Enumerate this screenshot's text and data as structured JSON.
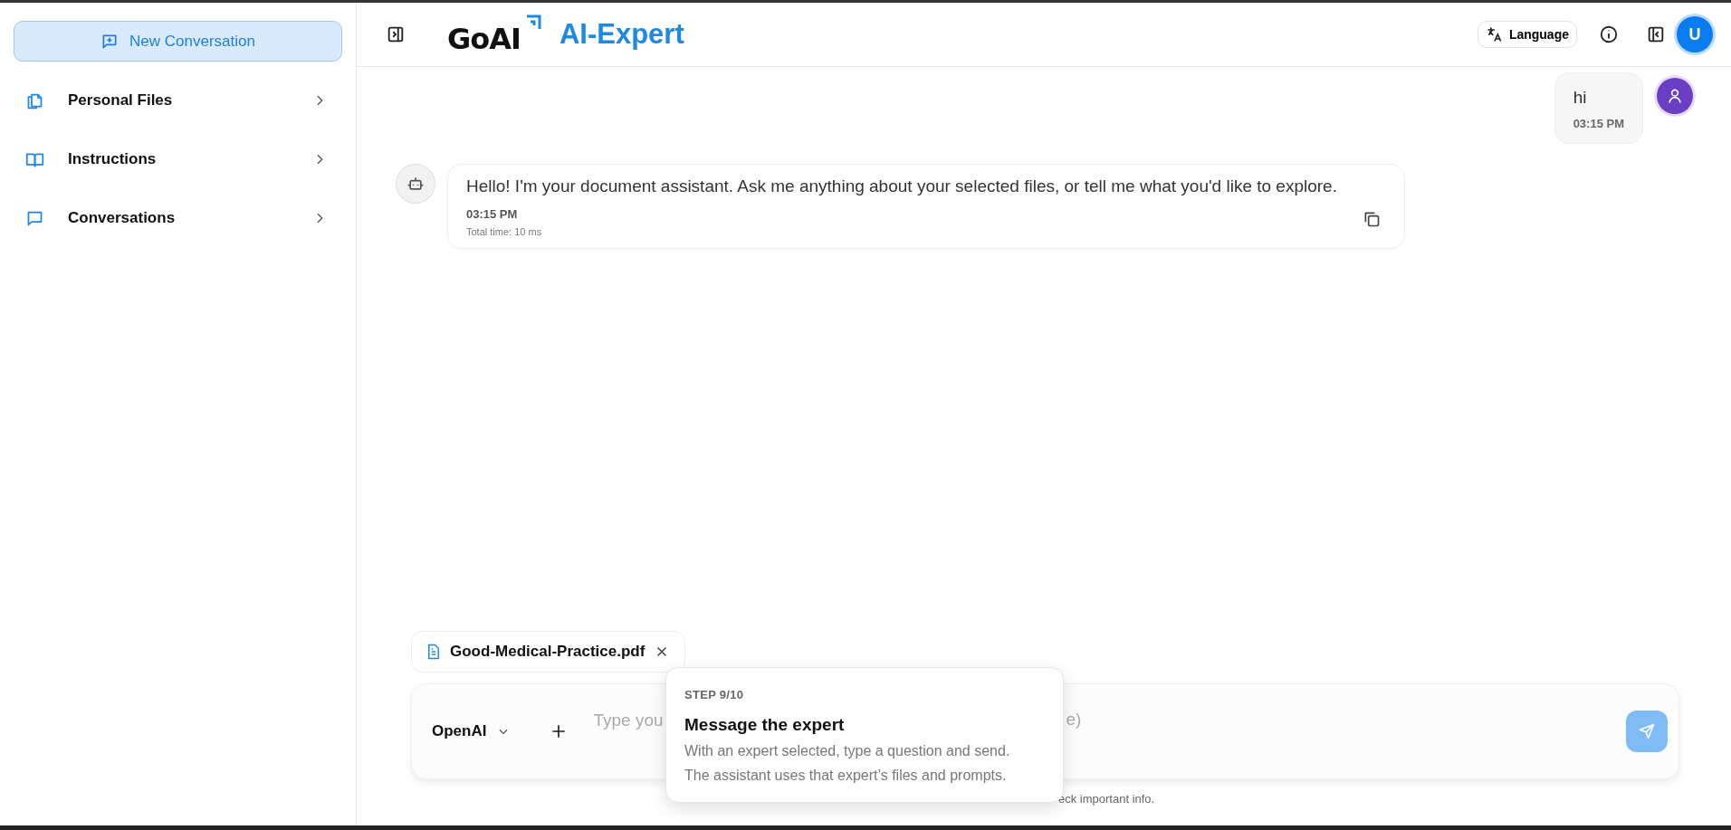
{
  "sidebar": {
    "new_button": "New Conversation",
    "items": [
      {
        "label": "Personal Files",
        "kind": "files"
      },
      {
        "label": "Instructions",
        "kind": "book"
      },
      {
        "label": "Conversations",
        "kind": "chat"
      }
    ]
  },
  "header": {
    "logo": "GoAI",
    "title": "AI-Expert",
    "language_button": "Language",
    "avatar": "U"
  },
  "messages": [
    {
      "kind": "user",
      "text": "hi",
      "time": "03:15 PM"
    },
    {
      "kind": "assistant",
      "text": "Hello! I'm your document assistant. Ask me anything about your selected files, or tell me what you'd like to explore.",
      "time": "03:15 PM",
      "total_time": "Total time: 10 ms"
    }
  ],
  "attachment": {
    "name": "Good-Medical-Practice.pdf"
  },
  "composer": {
    "model": "OpenAI",
    "placeholder": "Type you",
    "placeholder_tail": "e)"
  },
  "footer_note": "eck important info.",
  "tour": {
    "step": "STEP 9/10",
    "title": "Message the expert",
    "lines": [
      "With an expert selected, type a question and send.",
      "The assistant uses that expert’s files and prompts."
    ]
  }
}
